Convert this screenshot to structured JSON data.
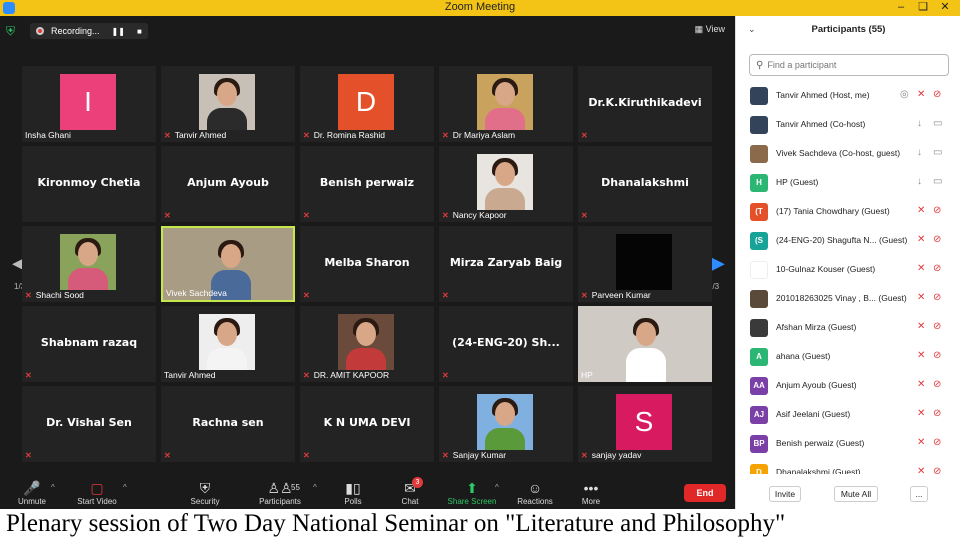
{
  "window": {
    "title": "Zoom Meeting"
  },
  "recording": {
    "label": "Recording..."
  },
  "view_label": "View",
  "page_indicator": "1/3",
  "colors": {
    "titlebar": "#f3c416",
    "muted_icon": "#e0393e",
    "active_speaker_border": "#c4e84a",
    "share_green": "#2ec866",
    "end_red": "#e02828"
  },
  "tiles": [
    {
      "name": "Insha Ghani",
      "muted": false,
      "kind": "avatar",
      "letter": "I",
      "color": "#ec407a"
    },
    {
      "name": "Tanvir Ahmed",
      "muted": true,
      "kind": "photo",
      "photo_bg": "#c8c0b6",
      "shirt": "#2b2b2b"
    },
    {
      "name": "Dr. Romina Rashid",
      "muted": true,
      "kind": "avatar",
      "letter": "D",
      "color": "#e4502a"
    },
    {
      "name": "Dr Mariya Aslam",
      "muted": true,
      "kind": "photo",
      "photo_bg": "#c9a35e",
      "shirt": "#e26f8a"
    },
    {
      "name": "Dr.K.Kiruthikadevi",
      "muted": true,
      "kind": "name"
    },
    {
      "name": "Kironmoy Chetia",
      "muted": false,
      "kind": "name"
    },
    {
      "name": "Anjum Ayoub",
      "muted": true,
      "kind": "name"
    },
    {
      "name": "Benish perwaiz",
      "muted": true,
      "kind": "name"
    },
    {
      "name": "Nancy Kapoor",
      "muted": true,
      "kind": "photo",
      "photo_bg": "#e8e4df",
      "shirt": "#c9a98f"
    },
    {
      "name": "Dhanalakshmi",
      "muted": true,
      "kind": "name"
    },
    {
      "name": "Shachi Sood",
      "muted": true,
      "kind": "photo",
      "photo_bg": "#8aa35a",
      "shirt": "#d65a7a"
    },
    {
      "name": "Vivek Sachdeva",
      "muted": false,
      "kind": "video",
      "photo_bg": "#a89c84",
      "shirt": "#4a6a9a",
      "active": true
    },
    {
      "name": "Melba Sharon",
      "muted": true,
      "kind": "name"
    },
    {
      "name": "Mirza Zaryab Baig",
      "muted": true,
      "kind": "name"
    },
    {
      "name": "Parveen Kumar",
      "muted": true,
      "kind": "black"
    },
    {
      "name": "Shabnam razaq",
      "muted": true,
      "kind": "name"
    },
    {
      "name": "Tanvir Ahmed",
      "muted": false,
      "kind": "photo",
      "photo_bg": "#eeeeee",
      "shirt": "#f4f4f4"
    },
    {
      "name": "DR. AMIT KAPOOR",
      "muted": true,
      "kind": "photo",
      "photo_bg": "#6a4a3a",
      "shirt": "#c23a3a"
    },
    {
      "name": "(24-ENG-20) Sh...",
      "muted": true,
      "kind": "name"
    },
    {
      "name": "HP",
      "muted": false,
      "kind": "video",
      "photo_bg": "#cfcac4",
      "shirt": "#ffffff"
    },
    {
      "name": "Dr. Vishal Sen",
      "muted": true,
      "kind": "name"
    },
    {
      "name": "Rachna sen",
      "muted": true,
      "kind": "name"
    },
    {
      "name": "K N UMA DEVI",
      "muted": true,
      "kind": "name"
    },
    {
      "name": "Sanjay Kumar",
      "muted": true,
      "kind": "photo",
      "photo_bg": "#7fb0e0",
      "shirt": "#5a9a3a"
    },
    {
      "name": "sanjay yadav",
      "muted": true,
      "kind": "avatar",
      "letter": "S",
      "color": "#d81b60"
    }
  ],
  "toolbar": {
    "unmute": "Unmute",
    "start_video": "Start Video",
    "security": "Security",
    "participants": "Participants",
    "participants_count": "55",
    "polls": "Polls",
    "chat": "Chat",
    "chat_badge": "3",
    "share_screen": "Share Screen",
    "reactions": "Reactions",
    "more": "More",
    "end": "End"
  },
  "panel": {
    "title": "Participants (55)",
    "search_placeholder": "Find a participant",
    "participants": [
      {
        "name": "Tanvir Ahmed (Host, me)",
        "av": "",
        "color": "#33435a",
        "photo": true,
        "mic": "muted",
        "cam": "off",
        "extra": "rec"
      },
      {
        "name": "Tanvir Ahmed (Co-host)",
        "av": "",
        "color": "#33435a",
        "photo": true,
        "mic": "on",
        "cam": "on"
      },
      {
        "name": "Vivek Sachdeva (Co-host, guest)",
        "av": "",
        "color": "#8a6a4a",
        "photo": true,
        "mic": "on",
        "cam": "on"
      },
      {
        "name": "HP (Guest)",
        "av": "H",
        "color": "#2bb673",
        "mic": "on",
        "cam": "on"
      },
      {
        "name": "(17) Tania Chowdhary (Guest)",
        "av": "(T",
        "color": "#e4502a",
        "mic": "muted",
        "cam": "off"
      },
      {
        "name": "(24-ENG-20) Shagufta N... (Guest)",
        "av": "(S",
        "color": "#17a398",
        "mic": "muted",
        "cam": "off"
      },
      {
        "name": "10-Gulnaz Kouser (Guest)",
        "av": "",
        "color": "#ffffff",
        "mic": "muted",
        "cam": "off"
      },
      {
        "name": "201018263025 Vinay , B... (Guest)",
        "av": "",
        "color": "#5a4a3a",
        "photo": true,
        "mic": "muted",
        "cam": "off"
      },
      {
        "name": "Afshan Mirza (Guest)",
        "av": "",
        "color": "#3a3a3a",
        "photo": true,
        "mic": "muted",
        "cam": "off"
      },
      {
        "name": "ahana (Guest)",
        "av": "A",
        "color": "#2bb673",
        "mic": "muted",
        "cam": "off"
      },
      {
        "name": "Anjum Ayoub (Guest)",
        "av": "AA",
        "color": "#7b3fa8",
        "mic": "muted",
        "cam": "off"
      },
      {
        "name": "Asif Jeelani (Guest)",
        "av": "AJ",
        "color": "#7b3fa8",
        "mic": "muted",
        "cam": "off"
      },
      {
        "name": "Benish perwaiz (Guest)",
        "av": "BP",
        "color": "#7b3fa8",
        "mic": "muted",
        "cam": "off"
      },
      {
        "name": "Dhanalakshmi (Guest)",
        "av": "D",
        "color": "#f4a300",
        "mic": "muted",
        "cam": "off"
      }
    ],
    "invite": "Invite",
    "mute_all": "Mute All",
    "more": "..."
  },
  "caption": "Plenary session of Two Day National Seminar on \"Literature and Philosophy\""
}
